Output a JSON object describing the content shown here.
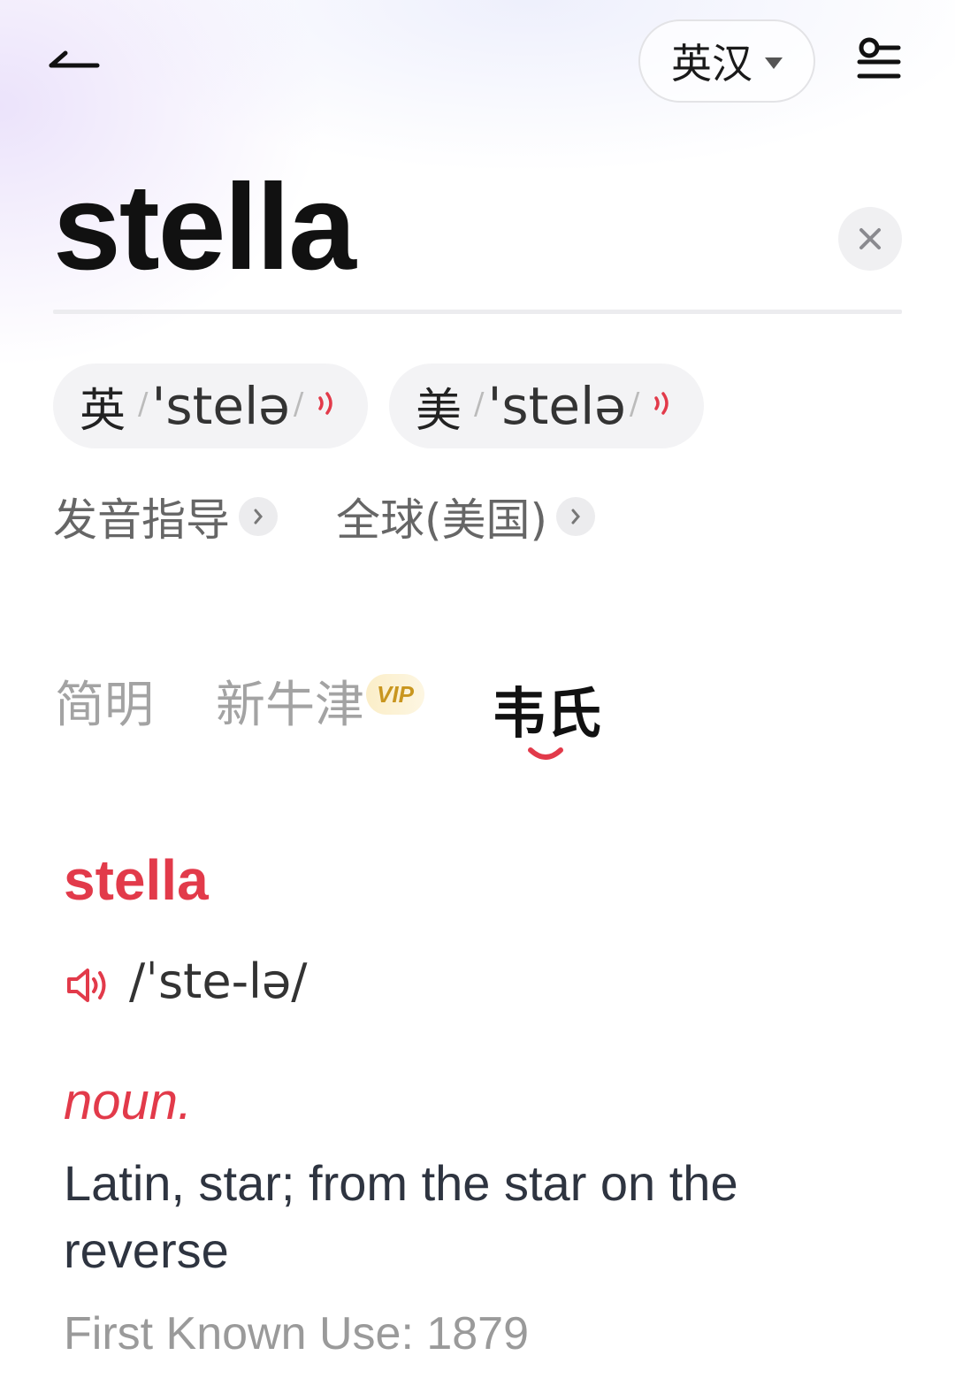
{
  "header": {
    "lang_label": "英汉"
  },
  "search": {
    "word": "stella"
  },
  "pronunciations": [
    {
      "region": "英",
      "ipa": "'stelə"
    },
    {
      "region": "美",
      "ipa": "'stelə"
    }
  ],
  "links": {
    "guide": "发音指导",
    "global": "全球(美国)"
  },
  "tabs": {
    "simple": "简明",
    "oxford": "新牛津",
    "oxford_badge": "VIP",
    "webster": "韦氏"
  },
  "entry": {
    "headword": "stella",
    "ipa": "/ˈste-lə/",
    "pos": "noun.",
    "definition": "Latin, star; from the star on the reverse",
    "first_known_use": "First Known Use: 1879"
  },
  "colors": {
    "accent": "#e23a4a",
    "vip_gold": "#c9961f"
  }
}
